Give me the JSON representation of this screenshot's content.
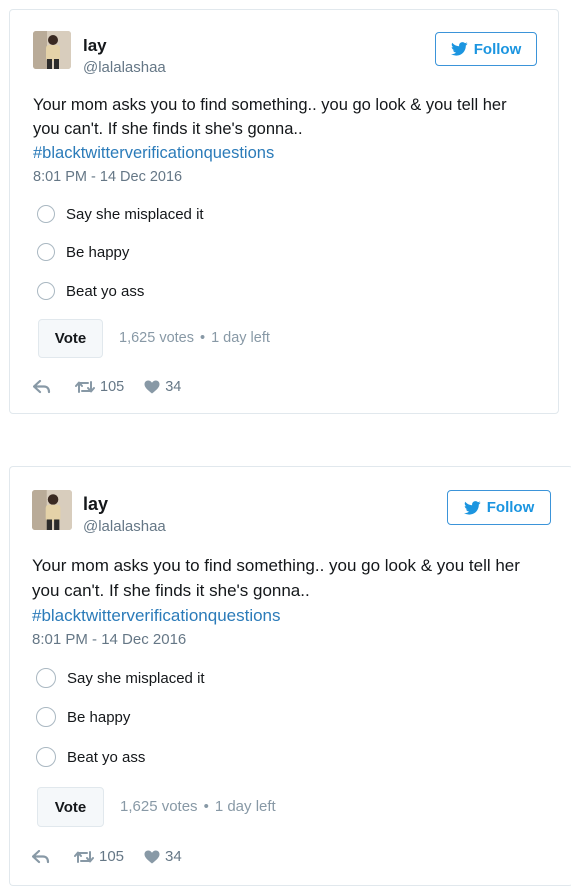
{
  "tweets": [
    {
      "name": "lay",
      "handle": "@lalalashaa",
      "follow_label": "Follow",
      "text": "Your mom asks you to find something.. you go look & you tell her you can't. If she finds it she's gonna..",
      "hashtag": "#blacktwitterverificationquestions",
      "timestamp": "8:01 PM - 14 Dec 2016",
      "options": [
        "Say she misplaced it",
        "Be happy",
        "Beat yo ass"
      ],
      "vote_label": "Vote",
      "votes": "1,625 votes",
      "separator": "•",
      "time_left": "1 day left",
      "retweets": "105",
      "likes": "34"
    },
    {
      "name": "lay",
      "handle": "@lalalashaa",
      "follow_label": "Follow",
      "text": "Your mom asks you to find something.. you go look & you tell her you can't. If she finds it she's gonna..",
      "hashtag": "#blacktwitterverificationquestions",
      "timestamp": "8:01 PM - 14 Dec 2016",
      "options": [
        "Say she misplaced it",
        "Be happy",
        "Beat yo ass"
      ],
      "vote_label": "Vote",
      "votes": "1,625 votes",
      "separator": "•",
      "time_left": "1 day left",
      "retweets": "105",
      "likes": "34"
    }
  ],
  "colors": {
    "twitter_blue": "#1b95e0",
    "hashtag": "#2b7bb9",
    "muted": "#657786",
    "border": "#e1e8ed"
  },
  "icons": [
    "twitter-bird-icon",
    "reply-icon",
    "retweet-icon",
    "heart-icon",
    "radio-icon"
  ]
}
